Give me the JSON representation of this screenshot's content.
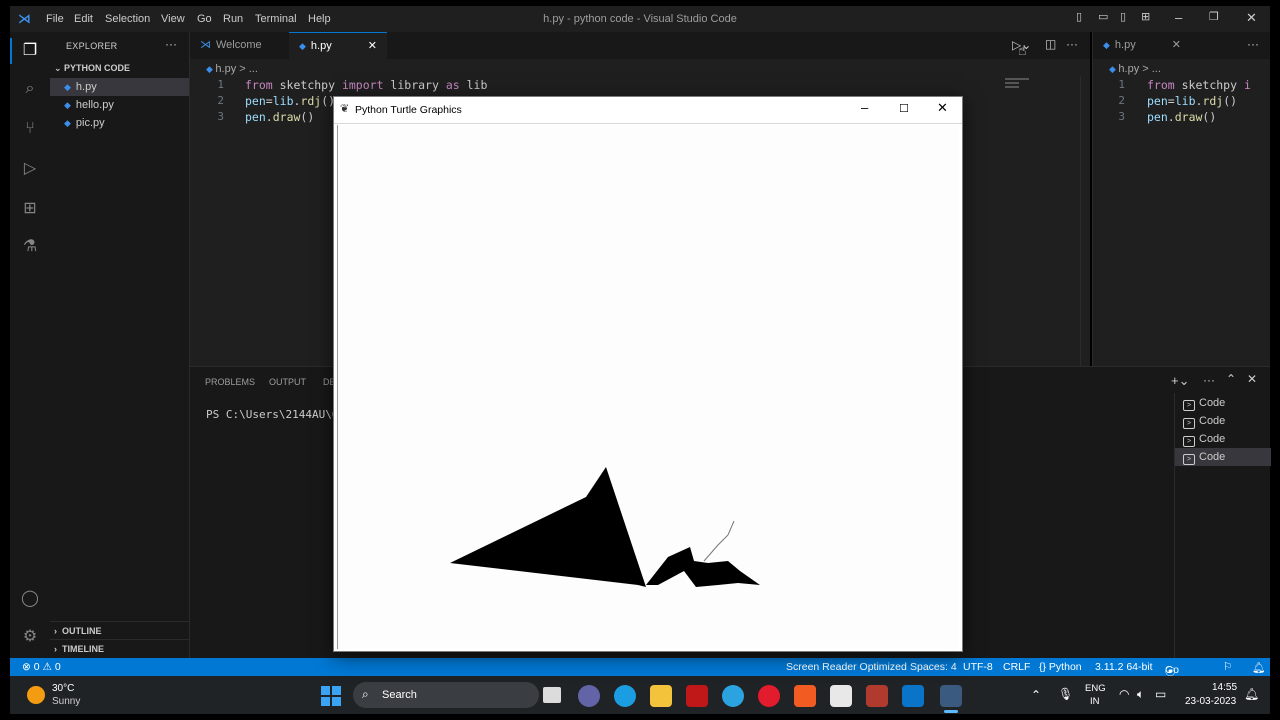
{
  "window": {
    "title": "h.py - python code - Visual Studio Code",
    "menu": [
      "File",
      "Edit",
      "Selection",
      "View",
      "Go",
      "Run",
      "Terminal",
      "Help"
    ]
  },
  "sidebar": {
    "header": "EXPLORER",
    "folder": "PYTHON CODE",
    "files": [
      "h.py",
      "hello.py",
      "pic.py"
    ],
    "outline": "OUTLINE",
    "timeline": "TIMELINE"
  },
  "editor": {
    "tabs": [
      "Welcome",
      "h.py"
    ],
    "breadcrumb": "h.py > ...",
    "lines": [
      {
        "n": "1",
        "parts": [
          [
            "kw",
            "from"
          ],
          [
            "df",
            " sketchpy "
          ],
          [
            "kw",
            "import"
          ],
          [
            "df",
            " library "
          ],
          [
            "kw",
            "as"
          ],
          [
            "df",
            " lib"
          ]
        ]
      },
      {
        "n": "2",
        "parts": [
          [
            "id",
            "pen"
          ],
          [
            "df",
            "="
          ],
          [
            "id",
            "lib"
          ],
          [
            "df",
            "."
          ],
          [
            "fn",
            "rdj"
          ],
          [
            "df",
            "()"
          ]
        ]
      },
      {
        "n": "3",
        "parts": [
          [
            "id",
            "pen"
          ],
          [
            "df",
            "."
          ],
          [
            "fn",
            "draw"
          ],
          [
            "df",
            "()"
          ]
        ]
      }
    ]
  },
  "split_editor": {
    "tab": "h.py",
    "breadcrumb": "h.py > ...",
    "lines": [
      {
        "n": "1",
        "parts": [
          [
            "kw",
            "from"
          ],
          [
            "df",
            " sketchpy "
          ],
          [
            "kw",
            "i"
          ]
        ]
      },
      {
        "n": "2",
        "parts": [
          [
            "id",
            "pen"
          ],
          [
            "df",
            "="
          ],
          [
            "id",
            "lib"
          ],
          [
            "df",
            "."
          ],
          [
            "fn",
            "rdj"
          ],
          [
            "df",
            "()"
          ]
        ]
      },
      {
        "n": "3",
        "parts": [
          [
            "id",
            "pen"
          ],
          [
            "df",
            "."
          ],
          [
            "fn",
            "draw"
          ],
          [
            "df",
            "()"
          ]
        ]
      }
    ]
  },
  "panel": {
    "tabs": [
      "PROBLEMS",
      "OUTPUT",
      "DE"
    ],
    "terminal_text": "PS C:\\Users\\2144AU\\On",
    "terminals": [
      "Code",
      "Code",
      "Code",
      "Code"
    ]
  },
  "turtle_window": {
    "title": "Python Turtle Graphics"
  },
  "status": {
    "errors": "0",
    "warnings": "0",
    "items": [
      "Screen Reader Optimized",
      "Spaces: 4",
      "UTF-8",
      "CRLF",
      "{} Python",
      "3.11.2 64-bit",
      "Go Live"
    ]
  },
  "taskbar": {
    "weather_temp": "30°C",
    "weather_desc": "Sunny",
    "search": "Search",
    "lang1": "ENG",
    "lang2": "IN",
    "time": "14:55",
    "date": "23-03-2023"
  },
  "colors": {
    "accent": "#0078d4",
    "editor_bg": "#1f1f1f",
    "sidebar_bg": "#181818"
  }
}
